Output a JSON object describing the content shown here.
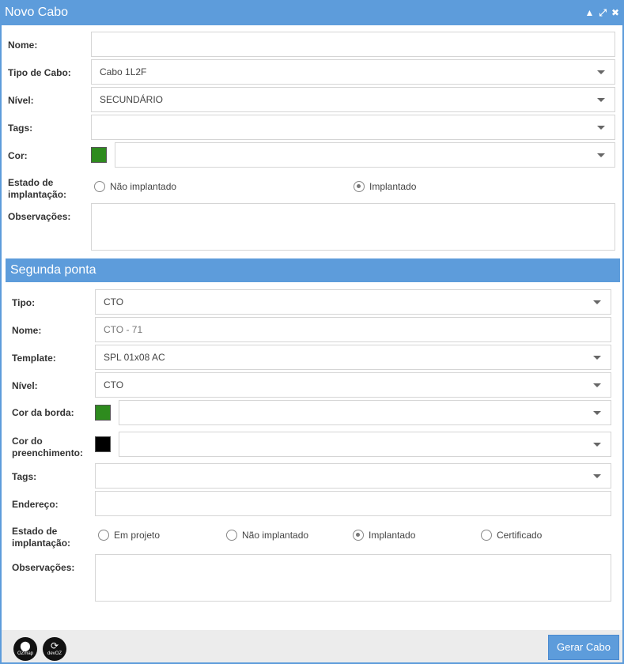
{
  "window": {
    "title": "Novo Cabo",
    "controls": {
      "collapse": "▲",
      "maximize": "⤢",
      "close": "✖"
    }
  },
  "cabo": {
    "nome_label": "Nome:",
    "nome_value": "",
    "tipo_label": "Tipo de Cabo:",
    "tipo_value": "Cabo 1L2F",
    "nivel_label": "Nível:",
    "nivel_value": "SECUNDÁRIO",
    "tags_label": "Tags:",
    "tags_value": "",
    "cor_label": "Cor:",
    "cor_color": "#2e8b1e",
    "cor_value": "",
    "estado_label": "Estado de implantação:",
    "estado_options": [
      {
        "label": "Não implantado",
        "checked": false
      },
      {
        "label": "Implantado",
        "checked": true
      }
    ],
    "obs_label": "Observações:",
    "obs_value": ""
  },
  "segunda_ponta": {
    "header": "Segunda ponta",
    "tipo_label": "Tipo:",
    "tipo_value": "CTO",
    "nome_label": "Nome:",
    "nome_value": "CTO - 71",
    "template_label": "Template:",
    "template_value": "SPL 01x08 AC",
    "nivel_label": "Nível:",
    "nivel_value": "CTO",
    "cor_borda_label": "Cor da borda:",
    "cor_borda_color": "#2e8b1e",
    "cor_preenchimento_label": "Cor do preenchimento:",
    "cor_preenchimento_color": "#000000",
    "tags_label": "Tags:",
    "endereco_label": "Endereço:",
    "endereco_value": "",
    "estado_label": "Estado de implantação:",
    "estado_options": [
      {
        "label": "Em projeto",
        "checked": false
      },
      {
        "label": "Não implantado",
        "checked": false
      },
      {
        "label": "Implantado",
        "checked": true
      },
      {
        "label": "Certificado",
        "checked": false
      }
    ],
    "obs_label": "Observações:"
  },
  "footer": {
    "logo1_text": "OZmap",
    "logo2_text": "devOZ",
    "submit_label": "Gerar Cabo"
  },
  "colors": {
    "accent": "#5d9cdb"
  }
}
